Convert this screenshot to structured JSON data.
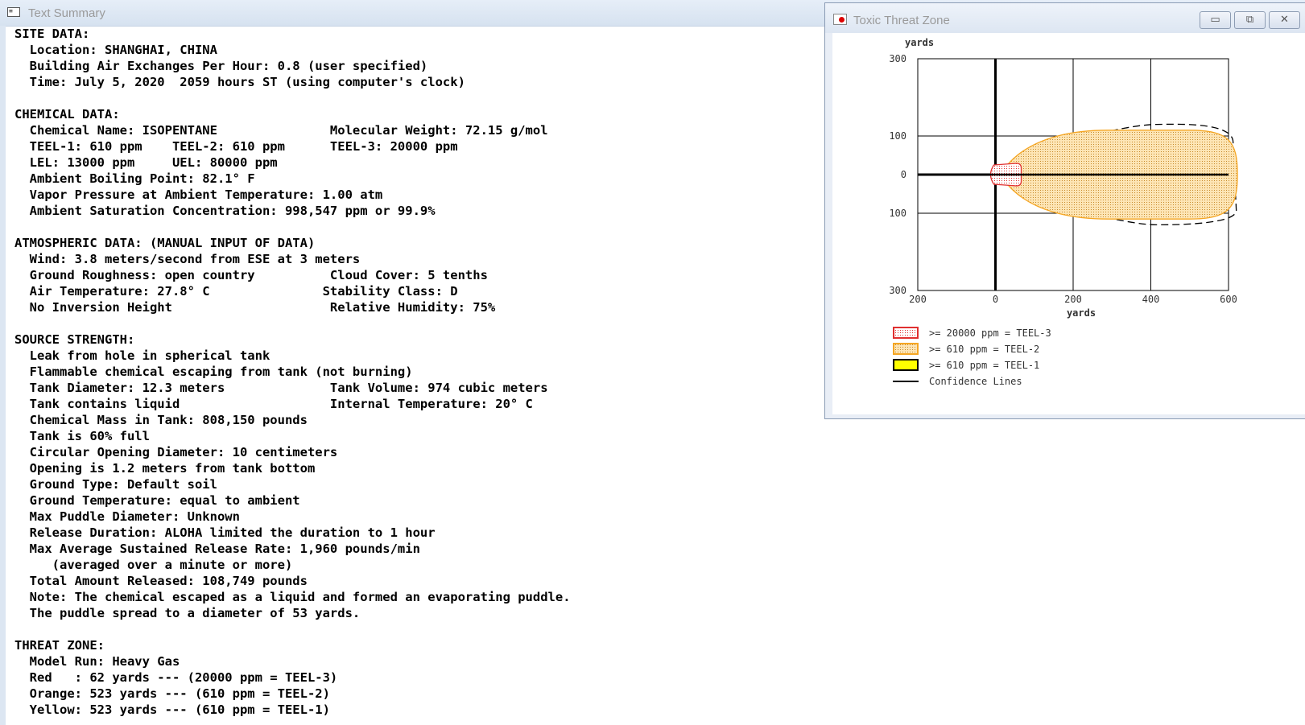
{
  "text_summary": {
    "title": "Text Summary",
    "lines": [
      "SITE DATA:",
      "  Location: SHANGHAI, CHINA",
      "  Building Air Exchanges Per Hour: 0.8 (user specified)",
      "  Time: July 5, 2020  2059 hours ST (using computer's clock)",
      "",
      "CHEMICAL DATA:",
      "  Chemical Name: ISOPENTANE               Molecular Weight: 72.15 g/mol",
      "  TEEL-1: 610 ppm    TEEL-2: 610 ppm      TEEL-3: 20000 ppm",
      "  LEL: 13000 ppm     UEL: 80000 ppm",
      "  Ambient Boiling Point: 82.1° F",
      "  Vapor Pressure at Ambient Temperature: 1.00 atm",
      "  Ambient Saturation Concentration: 998,547 ppm or 99.9%",
      "",
      "ATMOSPHERIC DATA: (MANUAL INPUT OF DATA)",
      "  Wind: 3.8 meters/second from ESE at 3 meters",
      "  Ground Roughness: open country          Cloud Cover: 5 tenths",
      "  Air Temperature: 27.8° C               Stability Class: D",
      "  No Inversion Height                     Relative Humidity: 75%",
      "",
      "SOURCE STRENGTH:",
      "  Leak from hole in spherical tank",
      "  Flammable chemical escaping from tank (not burning)",
      "  Tank Diameter: 12.3 meters              Tank Volume: 974 cubic meters",
      "  Tank contains liquid                    Internal Temperature: 20° C",
      "  Chemical Mass in Tank: 808,150 pounds",
      "  Tank is 60% full",
      "  Circular Opening Diameter: 10 centimeters",
      "  Opening is 1.2 meters from tank bottom",
      "  Ground Type: Default soil",
      "  Ground Temperature: equal to ambient",
      "  Max Puddle Diameter: Unknown",
      "  Release Duration: ALOHA limited the duration to 1 hour",
      "  Max Average Sustained Release Rate: 1,960 pounds/min",
      "     (averaged over a minute or more)",
      "  Total Amount Released: 108,749 pounds",
      "  Note: The chemical escaped as a liquid and formed an evaporating puddle.",
      "  The puddle spread to a diameter of 53 yards.",
      "",
      "THREAT ZONE:",
      "  Model Run: Heavy Gas",
      "  Red   : 62 yards --- (20000 ppm = TEEL-3)",
      "  Orange: 523 yards --- (610 ppm = TEEL-2)",
      "  Yellow: 523 yards --- (610 ppm = TEEL-1)"
    ]
  },
  "threat_zone_window": {
    "title": "Toxic Threat Zone",
    "buttons": {
      "minimize": "▭",
      "maximize": "⧉",
      "close": "✕"
    },
    "colors": {
      "red": "#e03030",
      "orange": "#f5a623",
      "orange_fill": "#fde5b5",
      "yellow": "#ffff00",
      "dark": "#000000"
    }
  },
  "chart_data": {
    "type": "area",
    "xlabel": "yards",
    "ylabel": "yards",
    "x_ticks": [
      {
        "value": -200,
        "label": "200"
      },
      {
        "value": 0,
        "label": "0"
      },
      {
        "value": 200,
        "label": "200"
      },
      {
        "value": 400,
        "label": "400"
      },
      {
        "value": 600,
        "label": "600"
      }
    ],
    "y_ticks": [
      {
        "value": 300,
        "label": "300"
      },
      {
        "value": 100,
        "label": "100"
      },
      {
        "value": 0,
        "label": "0"
      },
      {
        "value": -100,
        "label": "100"
      },
      {
        "value": -300,
        "label": "300"
      }
    ],
    "xlim": [
      -200,
      600
    ],
    "ylim": [
      -300,
      300
    ],
    "grid": true,
    "zones": [
      {
        "name": "red",
        "length": 62,
        "half_width": 25
      },
      {
        "name": "orange",
        "length": 523,
        "half_width": 90
      }
    ],
    "confidence_lines": {
      "length": 520,
      "half_width": 150
    },
    "legend_position": "bottom-left",
    "legend": [
      {
        "label": ">= 20000 ppm = TEEL-3",
        "swatch": "red"
      },
      {
        "label": ">= 610 ppm = TEEL-2",
        "swatch": "orange"
      },
      {
        "label": ">= 610 ppm = TEEL-1",
        "swatch": "yellow"
      },
      {
        "label": "Confidence Lines",
        "swatch": "line"
      }
    ]
  }
}
